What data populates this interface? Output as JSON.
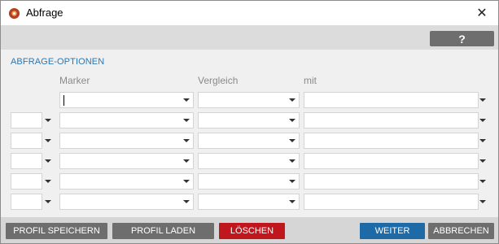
{
  "window": {
    "title": "Abfrage",
    "close_glyph": "✕",
    "app_icon": "settings-gear-icon"
  },
  "toolbar": {
    "help_label": "?"
  },
  "section": {
    "title": "ABFRAGE-OPTIONEN"
  },
  "columns": {
    "marker": "Marker",
    "vergleich": "Vergleich",
    "mit": "mit"
  },
  "footer": {
    "save_profile": "PROFIL SPEICHERN",
    "load_profile": "PROFIL LADEN",
    "delete": "LÖSCHEN",
    "next": "WEITER",
    "cancel": "ABBRECHEN"
  },
  "colors": {
    "accent_blue": "#1d6aa6",
    "delete_red": "#c0161e",
    "button_gray": "#6e6e6e",
    "section_blue": "#2a78b4"
  }
}
